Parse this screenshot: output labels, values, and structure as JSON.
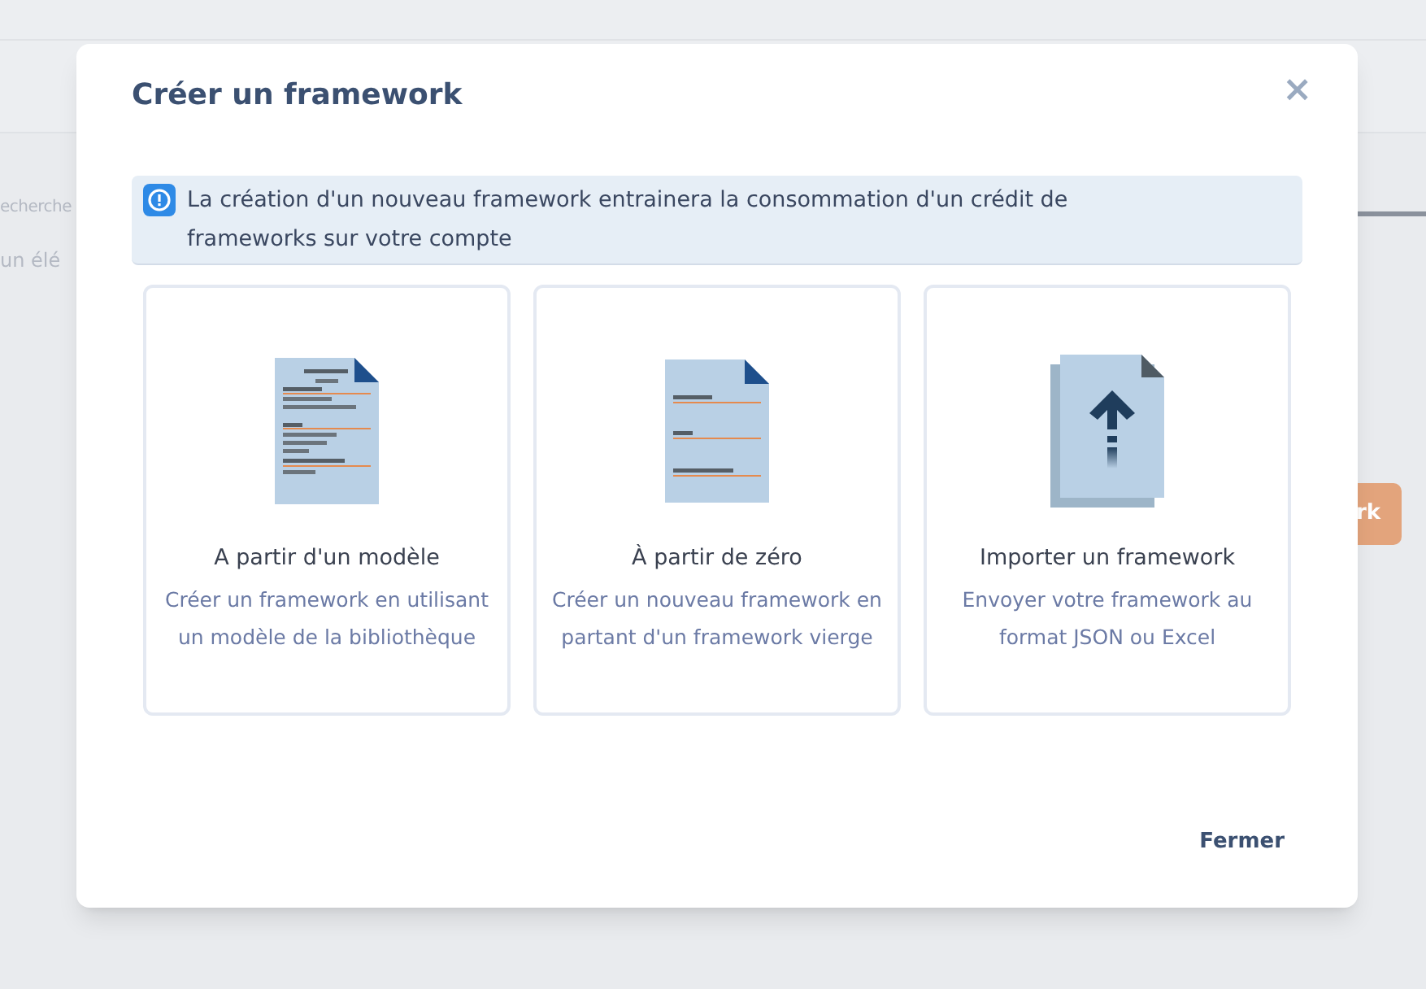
{
  "background": {
    "search_text": "echerche",
    "list_text": "un élé",
    "button_text": "rk"
  },
  "dialog": {
    "title": "Créer un framework",
    "close": "×",
    "alert": {
      "text": "La création d'un nouveau framework entrainera la consommation d'un crédit de frameworks sur votre compte"
    },
    "options": [
      {
        "kind": "template",
        "title": "A partir d'un modèle",
        "description": "Créer un framework en utilisant un modèle de la bibliothèque"
      },
      {
        "kind": "blank",
        "title": "À partir de zéro",
        "description": "Créer un nouveau framework en partant d'un framework vierge"
      },
      {
        "kind": "import",
        "title": "Importer un framework",
        "description": "Envoyer votre framework au format JSON ou Excel"
      }
    ],
    "close_button": "Fermer"
  }
}
